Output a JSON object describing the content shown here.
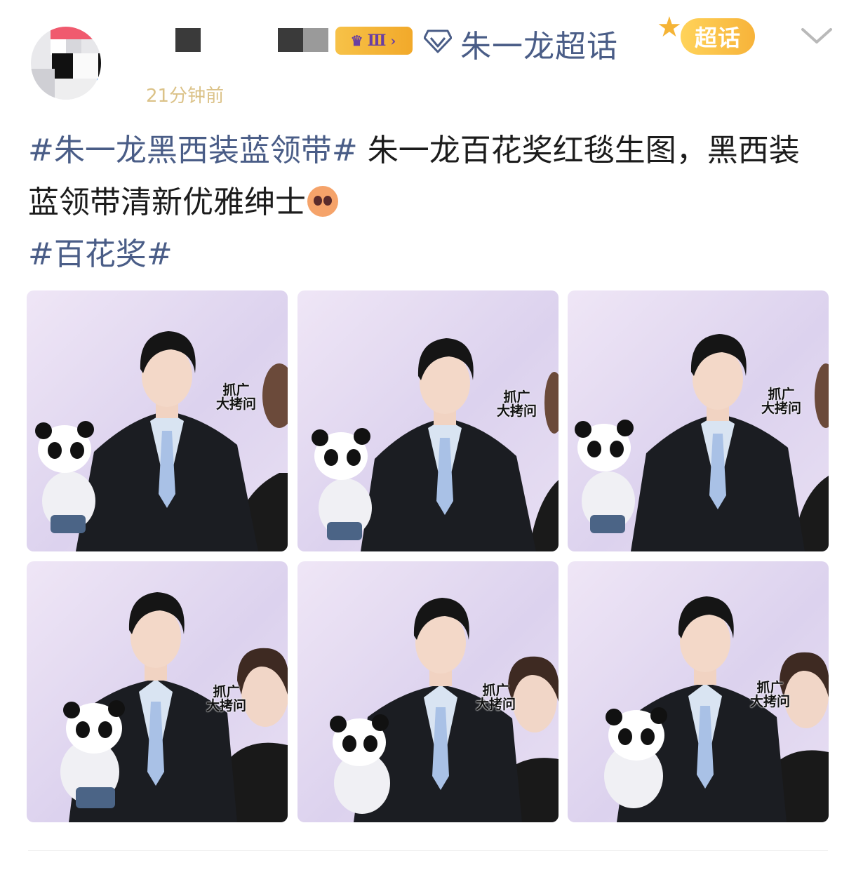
{
  "post": {
    "topic_name": "朱一龙超话",
    "rank_label": "Ⅲ",
    "chaohua_badge": "超话",
    "time_text": "21分钟前",
    "hashtag_main": "#朱一龙黑西装蓝领带#",
    "body_text": " 朱一龙百花奖红毯生图，黑西装蓝领带清新优雅绅士",
    "hashtag_secondary": "#百花奖#",
    "icons": [
      "avatar",
      "crown-icon",
      "diamond-icon",
      "star-icon",
      "chevron-down-icon",
      "emoji-icon"
    ]
  },
  "photos": [
    {
      "watermark": "抓广\n大拷问"
    },
    {
      "watermark": "抓广\n大拷问"
    },
    {
      "watermark": "抓广\n大拷问"
    },
    {
      "watermark": "抓广\n大拷问"
    },
    {
      "watermark": "抓广\n大拷问"
    },
    {
      "watermark": "抓广\n大拷问"
    }
  ],
  "colors": {
    "link": "#4a5d87",
    "text": "#1c1c1c",
    "badge_gold": "#f7b33a"
  }
}
